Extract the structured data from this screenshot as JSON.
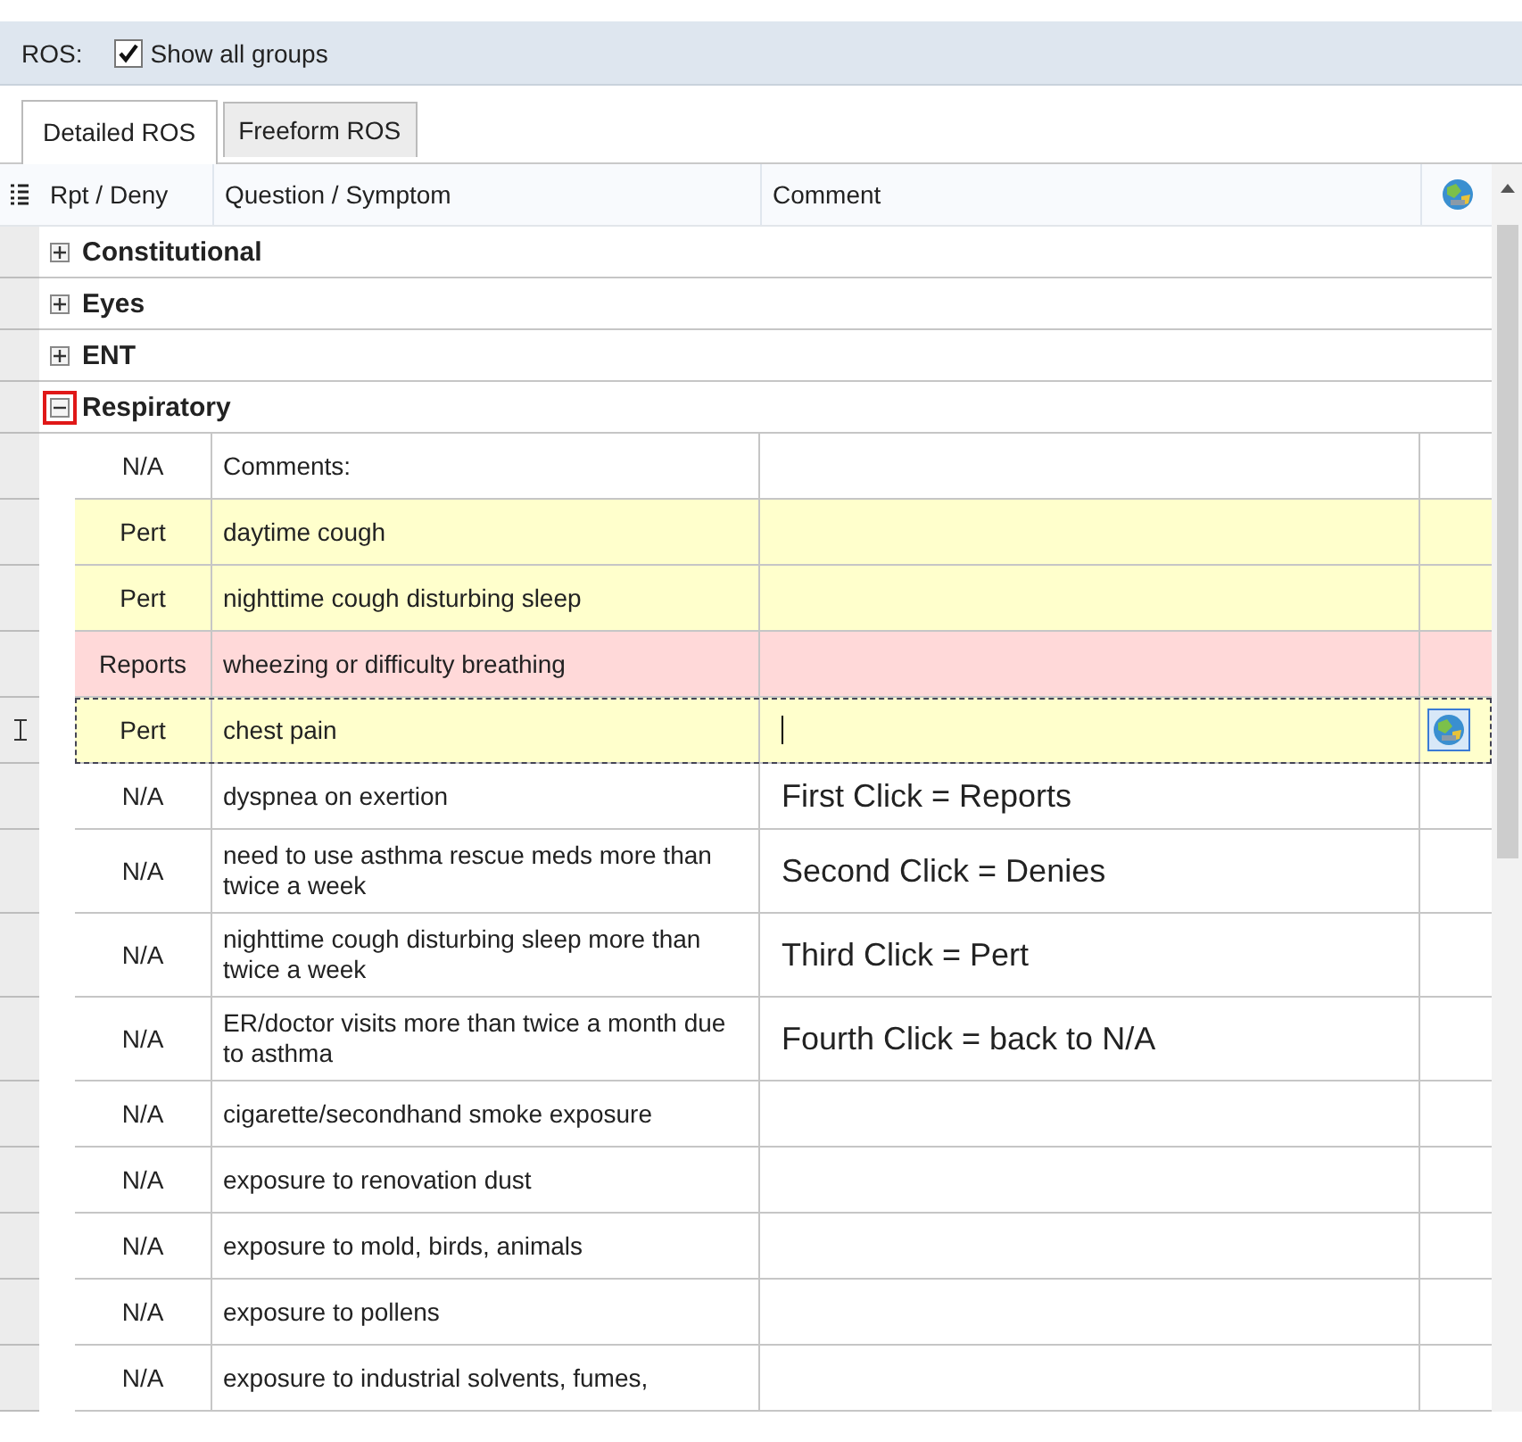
{
  "toolbar": {
    "label": "ROS:",
    "show_all_groups": {
      "label": "Show all groups",
      "checked": true
    }
  },
  "tabs": [
    {
      "label": "Detailed ROS",
      "selected": true
    },
    {
      "label": "Freeform ROS",
      "selected": false
    }
  ],
  "table": {
    "columns": [
      "Rpt / Deny",
      "Question / Symptom",
      "Comment"
    ],
    "groups": [
      {
        "name": "Constitutional",
        "expanded": false,
        "marked": false
      },
      {
        "name": "Eyes",
        "expanded": false,
        "marked": false
      },
      {
        "name": "ENT",
        "expanded": false,
        "marked": false
      },
      {
        "name": "Respiratory",
        "expanded": true,
        "marked": true,
        "items": [
          {
            "status": "N/A",
            "question": "Comments:",
            "color": "#ffffff",
            "selected": false
          },
          {
            "status": "Pert",
            "question": "daytime cough",
            "color": "#ffffcc",
            "selected": false
          },
          {
            "status": "Pert",
            "question": "nighttime cough disturbing sleep",
            "color": "#ffffcc",
            "selected": false
          },
          {
            "status": "Reports",
            "question": "wheezing or difficulty breathing",
            "color": "#ffd9d9",
            "selected": false
          },
          {
            "status": "Pert",
            "question": "chest pain",
            "color": "#ffffcc",
            "selected": true
          },
          {
            "status": "N/A",
            "question": "dyspnea on exertion",
            "comment": "First Click = Reports",
            "color": "#ffffff",
            "selected": false
          },
          {
            "status": "N/A",
            "question": "need to use asthma rescue meds more than twice a week",
            "comment": "Second Click = Denies",
            "color": "#ffffff",
            "selected": false
          },
          {
            "status": "N/A",
            "question": "nighttime cough disturbing sleep more than twice a week",
            "comment": "Third Click = Pert",
            "color": "#ffffff",
            "selected": false
          },
          {
            "status": "N/A",
            "question": "ER/doctor visits more than twice a month due to asthma",
            "comment": "Fourth Click = back to N/A",
            "color": "#ffffff",
            "selected": false
          },
          {
            "status": "N/A",
            "question": "cigarette/secondhand smoke exposure",
            "color": "#ffffff",
            "selected": false
          },
          {
            "status": "N/A",
            "question": "exposure to renovation dust",
            "color": "#ffffff",
            "selected": false
          },
          {
            "status": "N/A",
            "question": "exposure to mold, birds, animals",
            "color": "#ffffff",
            "selected": false
          },
          {
            "status": "N/A",
            "question": "exposure to pollens",
            "color": "#ffffff",
            "selected": false
          },
          {
            "status": "N/A",
            "question": "exposure to industrial solvents, fumes,",
            "color": "#ffffff",
            "selected": false
          }
        ]
      }
    ]
  }
}
